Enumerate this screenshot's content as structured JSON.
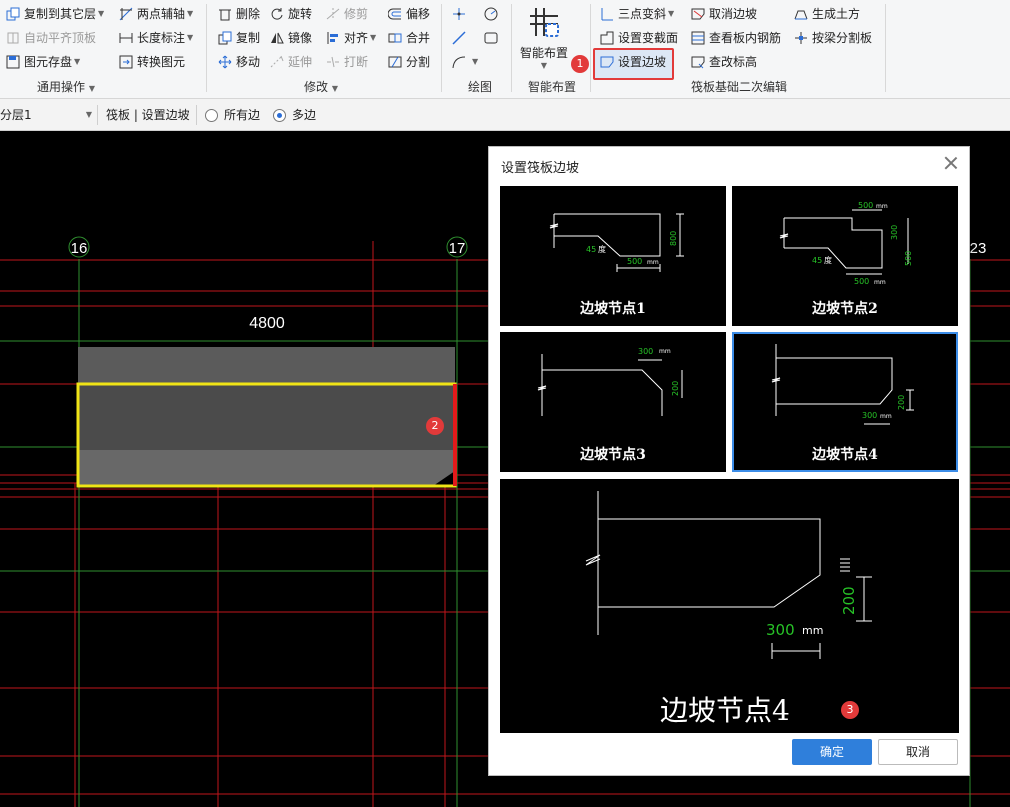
{
  "ribbon": {
    "common_ops": {
      "title": "通用操作",
      "copy_to_other_layer": "复制到其它层",
      "auto_align_top": "自动平齐顶板",
      "element_storage": "图元存盘",
      "two_point_axis": "两点辅轴",
      "length_mark": "长度标注",
      "convert_element": "转换图元"
    },
    "modify": {
      "title": "修改",
      "delete": "删除",
      "copy": "复制",
      "move": "移动",
      "rotate": "旋转",
      "mirror": "镜像",
      "extend": "延伸",
      "trim": "修剪",
      "align": "对齐",
      "break": "打断",
      "offset": "偏移",
      "merge": "合并",
      "split": "分割"
    },
    "draw": {
      "title": "绘图"
    },
    "smart": {
      "title": "智能布置",
      "smart_layout": "智能布置"
    },
    "raft_edit": {
      "title": "筏板基础二次编辑",
      "three_point_slope": "三点变斜",
      "set_section_change": "设置变截面",
      "set_edge_slope": "设置边坡",
      "cancel_edge_slope": "取消边坡",
      "view_inner_rebar": "查看板内钢筋",
      "check_elevation": "查改标高",
      "generate_earthwork": "生成土方",
      "split_by_beam": "按梁分割板"
    }
  },
  "options_bar": {
    "layer": "分层1",
    "breadcrumb": "筏板 | 设置边坡",
    "radio_all_edges": "所有边",
    "radio_multi_edges": "多边",
    "selected": "多边"
  },
  "canvas": {
    "axis_16": "16",
    "axis_17": "17",
    "axis_23": "23",
    "dimension": "4800"
  },
  "badges": {
    "b1": "1",
    "b2": "2",
    "b3": "3"
  },
  "dialog": {
    "title": "设置筏板边坡",
    "thumbs": [
      {
        "label": "边坡节点1",
        "angle": "45",
        "angle_unit": "度",
        "width": "500",
        "unit": "mm",
        "height": "800"
      },
      {
        "label": "边坡节点2",
        "angle": "45",
        "angle_unit": "度",
        "top_width": "500",
        "bottom_width": "500",
        "unit": "mm",
        "height_a": "300",
        "height_b": "500"
      },
      {
        "label": "边坡节点3",
        "width": "300",
        "unit": "mm",
        "height": "200"
      },
      {
        "label": "边坡节点4",
        "width": "300",
        "unit": "mm",
        "height": "200"
      }
    ],
    "preview": {
      "label": "边坡节点4",
      "width": "300",
      "unit": "mm",
      "height": "200"
    },
    "ok": "确定",
    "cancel": "取消"
  },
  "colors": {
    "accent": "#2f7fdb",
    "highlight": "#e23a3a",
    "grid_red": "#c0161b",
    "grid_green": "#2f8f2f",
    "selection_yellow": "#f0e416",
    "dim_green": "#27c227"
  }
}
